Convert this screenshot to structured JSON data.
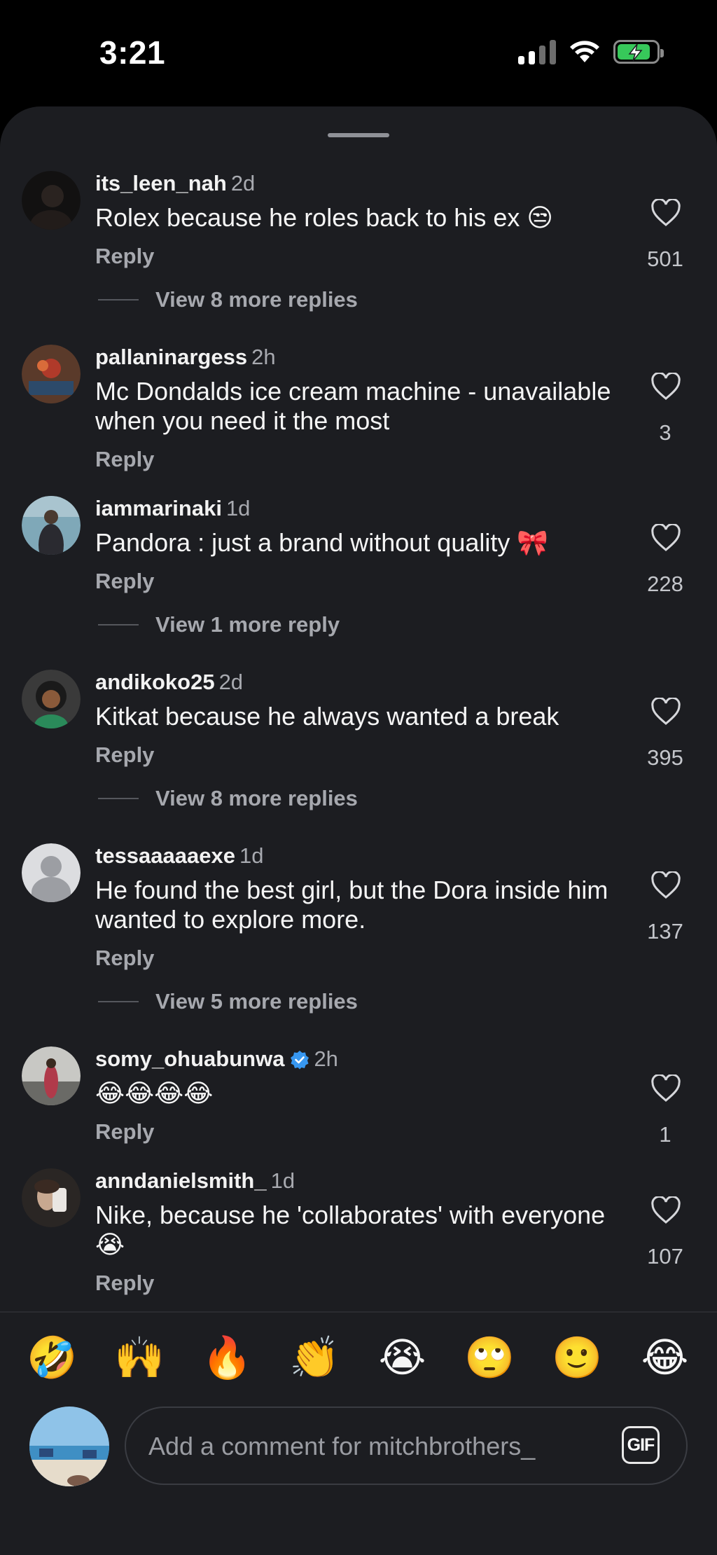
{
  "status_bar": {
    "time": "3:21"
  },
  "colors": {
    "sheet_bg": "#1c1d21",
    "accent_verified": "#3797f0",
    "battery_green": "#37c85a"
  },
  "comments": [
    {
      "username": "its_leen_nah",
      "time": "2d",
      "text": "Rolex because he roles back to his ex 😒",
      "reply": "Reply",
      "likes": "501",
      "view_more": "View 8 more replies",
      "avatar_icon": "avatar-dark"
    },
    {
      "username": "pallaninargess",
      "time": "2h",
      "text": "Mc Dondalds ice cream machine - unavailable when you need it the most",
      "reply": "Reply",
      "likes": "3",
      "avatar_icon": "avatar-red"
    },
    {
      "username": "iammarinaki",
      "time": "1d",
      "text": "Pandora : just a brand without quality 🎀",
      "reply": "Reply",
      "likes": "228",
      "view_more": "View 1 more reply",
      "avatar_icon": "avatar-photo"
    },
    {
      "username": "andikoko25",
      "time": "2d",
      "text": "Kitkat because he always wanted a break",
      "reply": "Reply",
      "likes": "395",
      "view_more": "View 8 more replies",
      "avatar_icon": "avatar-person"
    },
    {
      "username": "tessaaaaaexe",
      "time": "1d",
      "text": "He found the best girl, but the Dora inside him wanted to explore more.",
      "reply": "Reply",
      "likes": "137",
      "view_more": "View 5 more replies",
      "avatar_icon": "default-avatar-icon"
    },
    {
      "username": "somy_ohuabunwa",
      "time": "2h",
      "text": "😂😂😂😂",
      "reply": "Reply",
      "likes": "1",
      "verified": true,
      "avatar_icon": "avatar-person"
    },
    {
      "username": "anndanielsmith_",
      "time": "1d",
      "text": "Nike, because he 'collaborates' with everyone 😭",
      "reply": "Reply",
      "likes": "107",
      "avatar_icon": "avatar-photo"
    }
  ],
  "emoji_bar": [
    "🤣",
    "🙌",
    "🔥",
    "👏",
    "😭",
    "🙄",
    "🙂",
    "😂"
  ],
  "composer": {
    "placeholder": "Add a comment for mitchbrothers_",
    "gif_label": "GIF"
  }
}
